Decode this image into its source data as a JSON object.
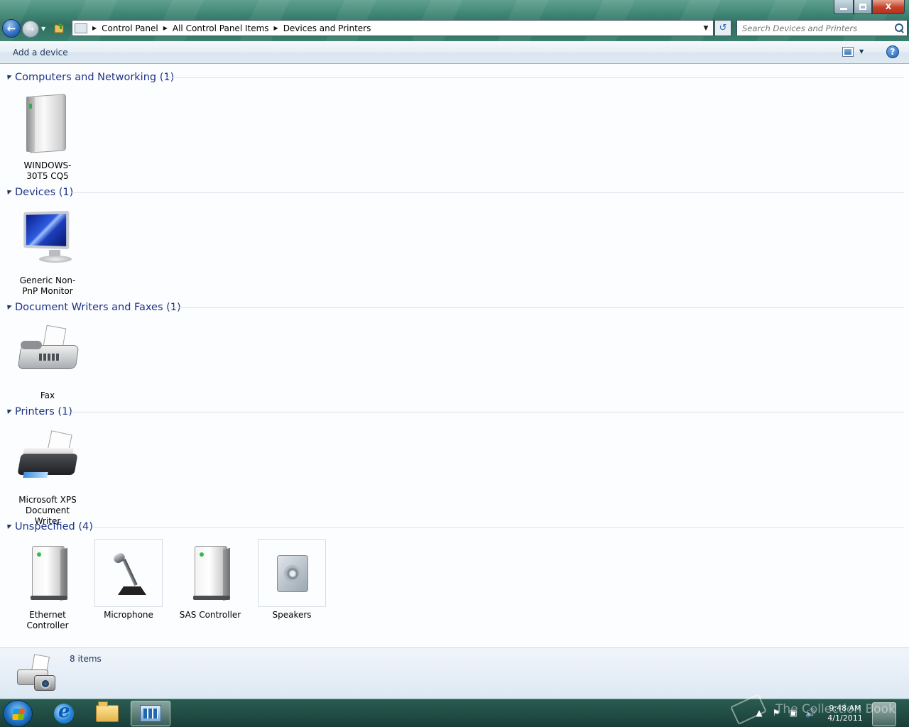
{
  "window": {
    "buttons": {
      "minimize": "",
      "maximize": "",
      "close": "X"
    }
  },
  "nav": {
    "breadcrumbs": [
      "Control Panel",
      "All Control Panel Items",
      "Devices and Printers"
    ],
    "search_placeholder": "Search Devices and Printers"
  },
  "commandbar": {
    "add_device": "Add a device",
    "help": "?"
  },
  "groups": [
    {
      "title": "Computers and Networking (1)",
      "items": [
        {
          "label": "WINDOWS-30T5 CQ5",
          "icon": "computer-icon"
        }
      ]
    },
    {
      "title": "Devices (1)",
      "items": [
        {
          "label": "Generic Non-PnP Monitor",
          "icon": "monitor-icon"
        }
      ]
    },
    {
      "title": "Document Writers and Faxes (1)",
      "items": [
        {
          "label": "Fax",
          "icon": "fax-icon"
        }
      ]
    },
    {
      "title": "Printers (1)",
      "items": [
        {
          "label": "Microsoft XPS Document Writer",
          "icon": "printer-icon"
        }
      ]
    },
    {
      "title": "Unspecified (4)",
      "items": [
        {
          "label": "Ethernet Controller",
          "icon": "device-box-icon"
        },
        {
          "label": "Microphone",
          "icon": "microphone-icon"
        },
        {
          "label": "SAS Controller",
          "icon": "device-box-icon"
        },
        {
          "label": "Speakers",
          "icon": "speaker-icon"
        }
      ]
    }
  ],
  "details": {
    "count": "8 items"
  },
  "taskbar": {
    "time": "9:48 AM",
    "date": "4/1/2011",
    "watermark": "The Collection Book"
  },
  "colors": {
    "group_header": "#1e3287",
    "accent": "#2a6cc0",
    "content_bg": "#fcfdfe"
  }
}
